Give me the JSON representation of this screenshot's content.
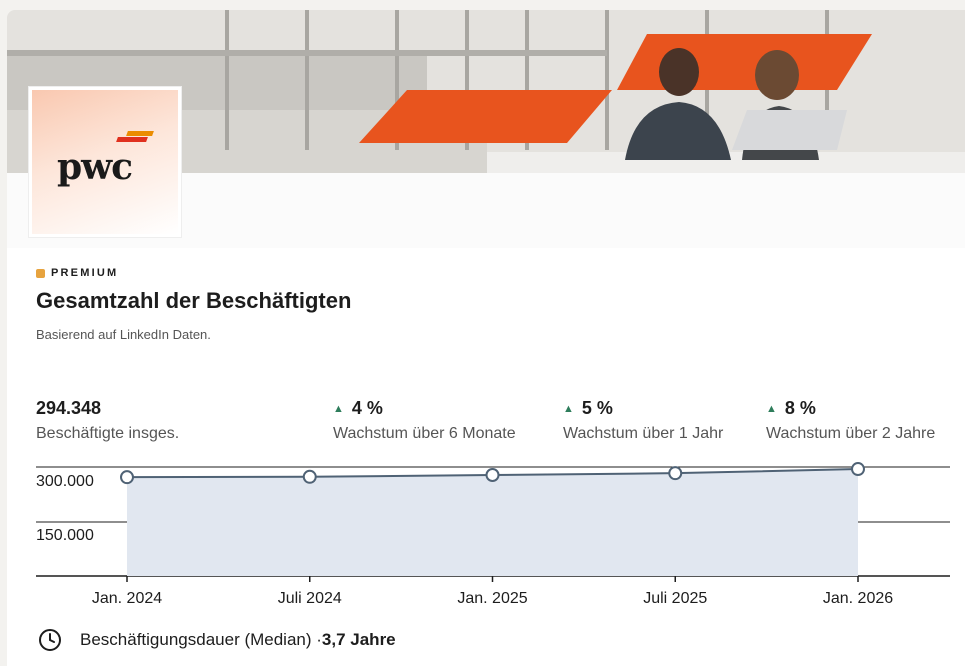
{
  "company": {
    "logo_text": "pwc"
  },
  "section": {
    "badge": "PREMIUM",
    "title": "Gesamtzahl der Beschäftigten",
    "subtitle": "Basierend auf LinkedIn Daten."
  },
  "stats": [
    {
      "value": "294.348",
      "label": "Beschäftigte insges.",
      "trend": ""
    },
    {
      "value": "4 %",
      "label": "Wachstum über 6 Monate",
      "trend": "up"
    },
    {
      "value": "5 %",
      "label": "Wachstum über 1 Jahr",
      "trend": "up"
    },
    {
      "value": "8 %",
      "label": "Wachstum über 2 Jahre",
      "trend": "up"
    }
  ],
  "chart_data": {
    "type": "area",
    "x": [
      "Jan. 2024",
      "Juli 2024",
      "Jan. 2025",
      "Juli 2025",
      "Jan. 2026"
    ],
    "series": [
      {
        "values": [
          272000,
          273000,
          278000,
          283000,
          294348
        ]
      }
    ],
    "y_ticks": [
      "300.000",
      "150.000"
    ],
    "ylim": [
      0,
      300000
    ],
    "grid": true
  },
  "tenure": {
    "label": "Beschäftigungsdauer (Median) · ",
    "value": "3,7 Jahre"
  },
  "colors": {
    "accent_orange": "#e8541e",
    "line": "#4f6275",
    "area_fill": "#e1e7f0",
    "trend_up": "#2e7d5b"
  }
}
